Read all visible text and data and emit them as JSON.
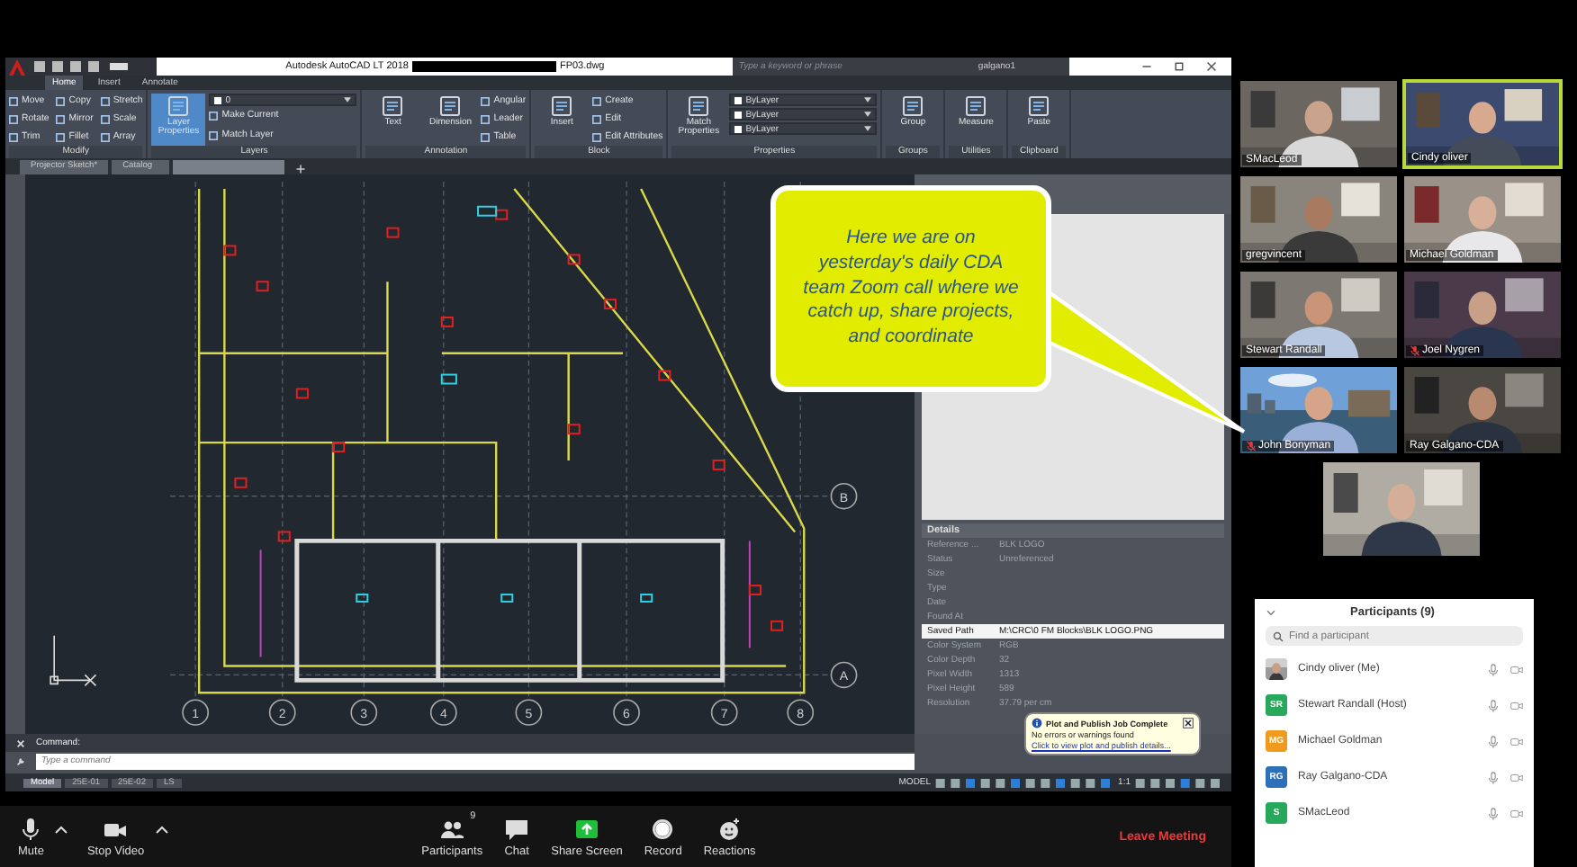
{
  "autocad": {
    "title": "Autodesk AutoCAD LT 2018",
    "file_name": "FP03.dwg",
    "search": {
      "placeholder": "Type a keyword or phrase"
    },
    "user": "galgano1",
    "ribbon_tabs": [
      {
        "label": "Home",
        "selected": true
      },
      {
        "label": "Insert",
        "selected": false
      },
      {
        "label": "Annotate",
        "selected": false
      }
    ],
    "panels": [
      {
        "title": "Modify",
        "tools": [
          "Move",
          "Rotate",
          "Trim",
          "Copy",
          "Mirror",
          "Fillet",
          "Stretch",
          "Scale",
          "Array"
        ]
      },
      {
        "title": "Layers",
        "large": [
          {
            "label": "Layer Properties",
            "active": true
          }
        ],
        "dropdowns": [
          "0"
        ],
        "tools": [
          "Make Current",
          "Match Layer"
        ]
      },
      {
        "title": "Annotation",
        "large": [
          {
            "label": "Text",
            "active": false
          },
          {
            "label": "Dimension",
            "active": false
          }
        ],
        "tools": [
          "Angular",
          "Leader",
          "Table"
        ]
      },
      {
        "title": "Block",
        "large": [
          {
            "label": "Insert",
            "active": false
          }
        ],
        "tools": [
          "Create",
          "Edit",
          "Edit Attributes"
        ]
      },
      {
        "title": "Properties",
        "large": [
          {
            "label": "Match Properties",
            "active": false
          }
        ],
        "dropdowns": [
          "ByLayer",
          "ByLayer",
          "ByLayer"
        ]
      },
      {
        "title": "Groups",
        "large": [
          {
            "label": "Group",
            "active": false
          }
        ]
      },
      {
        "title": "Utilities",
        "large": [
          {
            "label": "Measure",
            "active": false
          }
        ]
      },
      {
        "title": "Clipboard",
        "large": [
          {
            "label": "Paste",
            "active": false
          }
        ]
      }
    ],
    "doc_tabs": [
      {
        "label": "Projector Sketch*",
        "selected": false
      },
      {
        "label": "Catalog",
        "selected": false
      },
      {
        "selected": true
      }
    ],
    "grid_columns": [
      "1",
      "2",
      "3",
      "4",
      "5",
      "6",
      "7",
      "8"
    ],
    "grid_rows": [
      "B",
      "A"
    ],
    "command": {
      "label": "Command:",
      "placeholder": "Type a command"
    },
    "layout_tabs": [
      {
        "label": "Model",
        "selected": true
      },
      {
        "label": "25E-01",
        "selected": false
      },
      {
        "label": "25E-02",
        "selected": false
      },
      {
        "label": "LS",
        "selected": false
      }
    ],
    "status": {
      "mode": "MODEL",
      "scale": "1:1"
    },
    "details": {
      "title": "Details",
      "rows": [
        {
          "label": "Reference ...",
          "value": "BLK LOGO",
          "selected": false
        },
        {
          "label": "Status",
          "value": "Unreferenced",
          "selected": false
        },
        {
          "label": "Size",
          "selected": false
        },
        {
          "label": "Type",
          "selected": false
        },
        {
          "label": "Date",
          "selected": false
        },
        {
          "label": "Found At",
          "selected": false
        },
        {
          "label": "Saved Path",
          "value": "M:\\CRC\\0 FM Blocks\\BLK LOGO.PNG",
          "selected": true
        },
        {
          "label": "Color System",
          "value": "RGB",
          "selected": false
        },
        {
          "label": "Color Depth",
          "value": "32",
          "selected": false
        },
        {
          "label": "Pixel Width",
          "value": "1313",
          "selected": false
        },
        {
          "label": "Pixel Height",
          "value": "589",
          "selected": false
        },
        {
          "label": "Resolution",
          "value": "37.79 per cm",
          "selected": false
        }
      ]
    },
    "notification": {
      "title": "Plot and Publish Job Complete",
      "message": "No errors or warnings found",
      "link": "Click to view plot and publish details..."
    }
  },
  "callout": {
    "text": "Here we are on yesterday's daily CDA team Zoom call where we catch up, share projects, and coordinate"
  },
  "video_tiles": [
    {
      "name": "SMacLeod",
      "active": false,
      "muted": false
    },
    {
      "name": "Cindy oliver",
      "active": true,
      "muted": false
    },
    {
      "name": "gregvincent",
      "active": false,
      "muted": false
    },
    {
      "name": "Michael Goldman",
      "active": false,
      "muted": false
    },
    {
      "name": "Stewart Randall",
      "active": false,
      "muted": false
    },
    {
      "name": "Joel Nygren",
      "active": false,
      "muted": true
    },
    {
      "name": "John Bonyman",
      "active": false,
      "muted": true
    },
    {
      "name": "Ray Galgano-CDA",
      "active": false,
      "muted": false
    },
    {
      "active": false
    }
  ],
  "participants": {
    "title": "Participants (9)",
    "search": {
      "placeholder": "Find a participant"
    },
    "list": [
      {
        "name": "Cindy oliver (Me)"
      },
      {
        "name": "Stewart Randall (Host)",
        "kind": "initials",
        "initials": "SR",
        "color": "#27a85a"
      },
      {
        "name": "Michael Goldman",
        "kind": "initials",
        "initials": "MG",
        "color": "#f09a1e"
      },
      {
        "name": "Ray Galgano-CDA",
        "kind": "initials",
        "initials": "RG",
        "color": "#2d6fb8"
      },
      {
        "name": "SMacLeod",
        "kind": "initials",
        "initials": "S",
        "color": "#27a85a"
      }
    ]
  },
  "toolbar": [
    {
      "kind": "mute",
      "label": "Mute"
    },
    {
      "kind": "video",
      "label": "Stop Video"
    },
    {
      "kind": "participants",
      "label": "Participants",
      "count": "9"
    },
    {
      "kind": "chat",
      "label": "Chat"
    },
    {
      "kind": "share",
      "label": "Share Screen"
    },
    {
      "kind": "record",
      "label": "Record"
    },
    {
      "kind": "reactions",
      "label": "Reactions"
    },
    {
      "kind": "leave",
      "label": "Leave Meeting"
    }
  ]
}
